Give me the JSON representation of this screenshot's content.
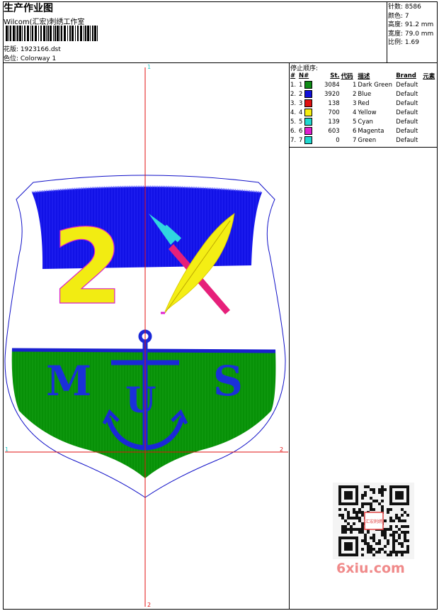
{
  "header": {
    "title": "生产作业图",
    "studio": "Wilcom(汇宏)刺绣工作室",
    "design_label": "花版: 1923166.dst",
    "colorway_label": "色位: Colorway 1"
  },
  "specs": {
    "stitches": "针数: 8586",
    "colors": "颜色: 7",
    "height": "高度: 91.2 mm",
    "width": "宽度: 79.0 mm",
    "scale": "比例: 1.69"
  },
  "stop_sequence": {
    "title": "停止顺序:",
    "headers": [
      "#",
      "N#",
      "St.",
      "代码",
      "描述",
      "Brand",
      "元素"
    ],
    "rows": [
      {
        "idx": "1.",
        "n": "1",
        "color": "#0e8a15",
        "st": "3084",
        "code": "1",
        "desc": "Dark Green",
        "brand": "Default"
      },
      {
        "idx": "2.",
        "n": "2",
        "color": "#1010d8",
        "st": "3920",
        "code": "2",
        "desc": "Blue",
        "brand": "Default"
      },
      {
        "idx": "3.",
        "n": "3",
        "color": "#e01010",
        "st": "138",
        "code": "3",
        "desc": "Red",
        "brand": "Default"
      },
      {
        "idx": "4.",
        "n": "4",
        "color": "#f6ee10",
        "st": "700",
        "code": "4",
        "desc": "Yellow",
        "brand": "Default"
      },
      {
        "idx": "5.",
        "n": "5",
        "color": "#20d8d0",
        "st": "139",
        "code": "5",
        "desc": "Cyan",
        "brand": "Default"
      },
      {
        "idx": "6.",
        "n": "6",
        "color": "#e020d0",
        "st": "603",
        "code": "6",
        "desc": "Magenta",
        "brand": "Default"
      },
      {
        "idx": "7.",
        "n": "7",
        "color": "#20d8d0",
        "st": "0",
        "code": "7",
        "desc": "Green",
        "brand": "Default"
      }
    ]
  },
  "canvas": {
    "marker_top": "1",
    "marker_left": "1",
    "marker_right": "2",
    "marker_bottom": "2",
    "design_text": {
      "number": "2",
      "left_letter": "M",
      "center_letter": "U",
      "right_letter": "S"
    }
  },
  "watermark": "6xiu.com",
  "qr_stamp": "汇宏刺绣"
}
